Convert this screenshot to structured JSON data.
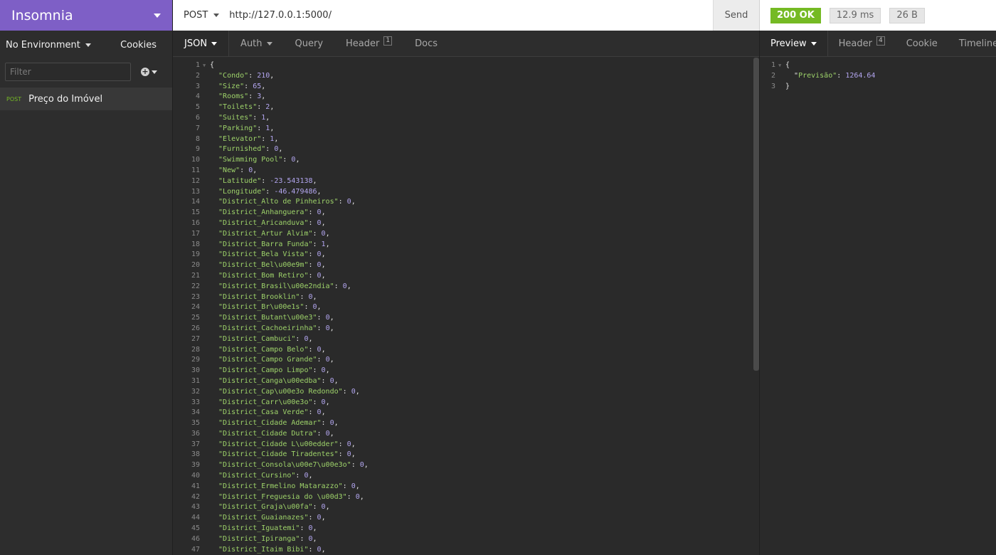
{
  "app": {
    "name": "Insomnia",
    "environment": "No Environment",
    "cookies_label": "Cookies",
    "filter_placeholder": "Filter"
  },
  "sidebar": {
    "requests": [
      {
        "method": "POST",
        "name": "Preço do Imóvel"
      }
    ]
  },
  "request": {
    "method": "POST",
    "url": "http://127.0.0.1:5000/",
    "send_label": "Send",
    "tabs": {
      "body": "JSON",
      "auth": "Auth",
      "query": "Query",
      "header": "Header",
      "header_count": "1",
      "docs": "Docs"
    },
    "body_lines": [
      {
        "k": "Condo",
        "v": "210"
      },
      {
        "k": "Size",
        "v": "65"
      },
      {
        "k": "Rooms",
        "v": "3"
      },
      {
        "k": "Toilets",
        "v": "2"
      },
      {
        "k": "Suites",
        "v": "1"
      },
      {
        "k": "Parking",
        "v": "1"
      },
      {
        "k": "Elevator",
        "v": "1"
      },
      {
        "k": "Furnished",
        "v": "0"
      },
      {
        "k": "Swimming Pool",
        "v": "0"
      },
      {
        "k": "New",
        "v": "0"
      },
      {
        "k": "Latitude",
        "v": "-23.543138"
      },
      {
        "k": "Longitude",
        "v": "-46.479486"
      },
      {
        "k": "District_Alto de Pinheiros",
        "v": "0"
      },
      {
        "k": "District_Anhanguera",
        "v": "0"
      },
      {
        "k": "District_Aricanduva",
        "v": "0"
      },
      {
        "k": "District_Artur Alvim",
        "v": "0"
      },
      {
        "k": "District_Barra Funda",
        "v": "1"
      },
      {
        "k": "District_Bela Vista",
        "v": "0"
      },
      {
        "k": "District_Bel\\u00e9m",
        "v": "0"
      },
      {
        "k": "District_Bom Retiro",
        "v": "0"
      },
      {
        "k": "District_Brasil\\u00e2ndia",
        "v": "0"
      },
      {
        "k": "District_Brooklin",
        "v": "0"
      },
      {
        "k": "District_Br\\u00e1s",
        "v": "0"
      },
      {
        "k": "District_Butant\\u00e3",
        "v": "0"
      },
      {
        "k": "District_Cachoeirinha",
        "v": "0"
      },
      {
        "k": "District_Cambuci",
        "v": "0"
      },
      {
        "k": "District_Campo Belo",
        "v": "0"
      },
      {
        "k": "District_Campo Grande",
        "v": "0"
      },
      {
        "k": "District_Campo Limpo",
        "v": "0"
      },
      {
        "k": "District_Canga\\u00edba",
        "v": "0"
      },
      {
        "k": "District_Cap\\u00e3o Redondo",
        "v": "0"
      },
      {
        "k": "District_Carr\\u00e3o",
        "v": "0"
      },
      {
        "k": "District_Casa Verde",
        "v": "0"
      },
      {
        "k": "District_Cidade Ademar",
        "v": "0"
      },
      {
        "k": "District_Cidade Dutra",
        "v": "0"
      },
      {
        "k": "District_Cidade L\\u00edder",
        "v": "0"
      },
      {
        "k": "District_Cidade Tiradentes",
        "v": "0"
      },
      {
        "k": "District_Consola\\u00e7\\u00e3o",
        "v": "0"
      },
      {
        "k": "District_Cursino",
        "v": "0"
      },
      {
        "k": "District_Ermelino Matarazzo",
        "v": "0"
      },
      {
        "k": "District_Freguesia do \\u00d3",
        "v": "0"
      },
      {
        "k": "District_Graja\\u00fa",
        "v": "0"
      },
      {
        "k": "District_Guaianazes",
        "v": "0"
      },
      {
        "k": "District_Iguatemi",
        "v": "0"
      },
      {
        "k": "District_Ipiranga",
        "v": "0"
      },
      {
        "k": "District_Itaim Bibi",
        "v": "0"
      }
    ]
  },
  "response": {
    "status": "200 OK",
    "time": "12.9 ms",
    "size": "26 B",
    "tabs": {
      "preview": "Preview",
      "header": "Header",
      "header_count": "4",
      "cookie": "Cookie",
      "timeline": "Timeline"
    },
    "body_key": "Previsão",
    "body_value": "1264.64"
  },
  "colors": {
    "brand": "#7e5fc6",
    "status_ok": "#75ba24",
    "json_key": "#9ed36a",
    "json_number": "#b3a6f0"
  }
}
